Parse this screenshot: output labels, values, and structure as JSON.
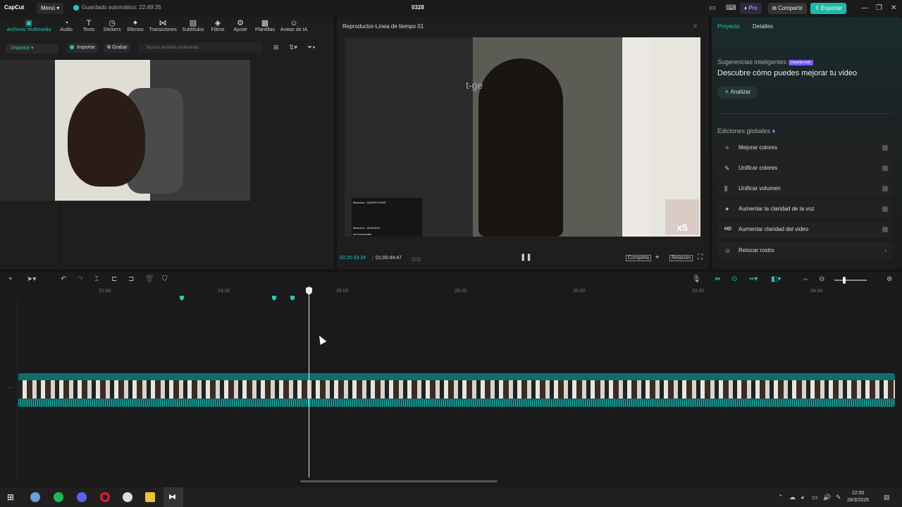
{
  "titlebar": {
    "app_name": "CapCut",
    "menu_label": "Menú",
    "autosave": "Guardado automático: 22:49:35",
    "project_name": "0328",
    "pro_label": "Pro",
    "share_label": "Compartir",
    "export_label": "Exportar"
  },
  "toolbar": {
    "items": [
      "Archivos multimedia",
      "Audio",
      "Texto",
      "Stickers",
      "Efectos",
      "Transiciones",
      "Subtítulos",
      "Filtros",
      "Ajuste",
      "Plantillas",
      "Avatar de IA"
    ]
  },
  "media": {
    "import_select": "Importar",
    "import_btn": "Importar",
    "record_btn": "Grabar",
    "search_placeholder": "Buscar archivos multimedia"
  },
  "player": {
    "title": "Reproductor-Línea de tiempo 01",
    "current_time": "00:25:33:24",
    "total_time": "01:00:44:47",
    "complete_label": "Completa",
    "ratio_label": "Relación",
    "watermark": "t-ge",
    "overlay_badge": "x5",
    "chat_lines": [
      "tilrancion : QUIERO KEKE",
      "",
      "",
      "",
      "tilrancion : JAJAJAJA",
      "me incomodas"
    ]
  },
  "right_panel": {
    "tab_project": "Proyecto",
    "tab_details": "Detalles",
    "suggestions_title": "Sugerencias inteligentes",
    "suggestions_badge": "Durante este",
    "headline": "Descubre cómo puedes mejorar tu video",
    "analyze_label": "Analizar",
    "global_title": "Ediciones globales",
    "global_items": [
      "Mejorar colores",
      "Unificar colores",
      "Unificar volumen",
      "Aumentar la claridad de la voz",
      "Aumentar claridad del video",
      "Retocar rostro"
    ]
  },
  "timeline": {
    "ruler_labels": [
      "22:00",
      "24:00",
      "26:00",
      "28:00",
      "30:00",
      "32:00",
      "34:00"
    ]
  },
  "taskbar": {
    "time": "22:50",
    "date": "28/3/2026"
  },
  "colors": {
    "accent": "#25c8b8",
    "export": "#1fb8a8",
    "track": "#0f6e6c"
  }
}
